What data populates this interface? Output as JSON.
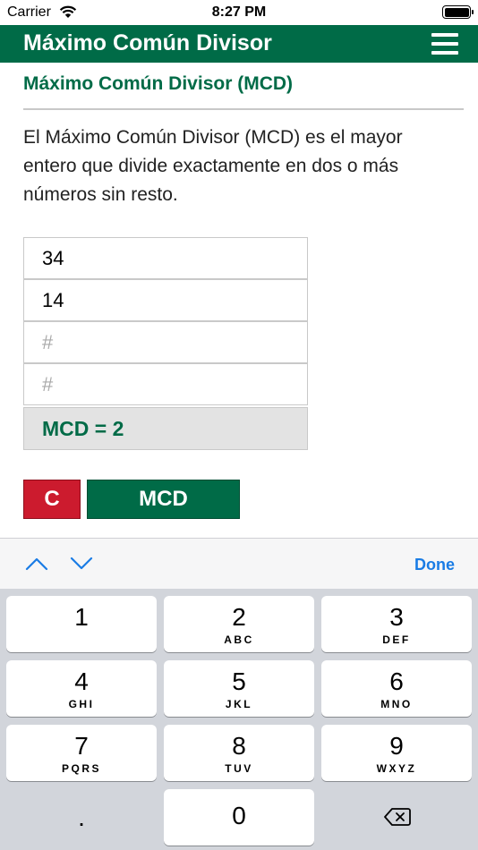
{
  "status_bar": {
    "carrier": "Carrier",
    "time": "8:27 PM",
    "icons": [
      "wifi-icon",
      "battery-icon"
    ]
  },
  "header": {
    "title": "Máximo Común Divisor",
    "menu_icon": "hamburger-menu-icon"
  },
  "section_title": "Máximo Común Divisor (MCD)",
  "description": "El Máximo Común Divisor (MCD) es el mayor entero que divide exactamente en dos o más números sin resto.",
  "inputs": [
    {
      "value": "34",
      "placeholder": "#"
    },
    {
      "value": "14",
      "placeholder": "#"
    },
    {
      "value": "",
      "placeholder": "#"
    },
    {
      "value": "",
      "placeholder": "#"
    }
  ],
  "result": "MCD = 2",
  "buttons": {
    "clear": "C",
    "calculate": "MCD"
  },
  "accessory": {
    "done": "Done",
    "icons": [
      "chevron-up-icon",
      "chevron-down-icon"
    ]
  },
  "keypad": {
    "keys": [
      {
        "digit": "1",
        "letters": ""
      },
      {
        "digit": "2",
        "letters": "ABC"
      },
      {
        "digit": "3",
        "letters": "DEF"
      },
      {
        "digit": "4",
        "letters": "GHI"
      },
      {
        "digit": "5",
        "letters": "JKL"
      },
      {
        "digit": "6",
        "letters": "MNO"
      },
      {
        "digit": "7",
        "letters": "PQRS"
      },
      {
        "digit": "8",
        "letters": "TUV"
      },
      {
        "digit": "9",
        "letters": "WXYZ"
      }
    ],
    "dot": ".",
    "zero": "0",
    "backspace_icon": "backspace-icon"
  },
  "colors": {
    "brand_green": "#006b47",
    "clear_red": "#cc1b2e",
    "link_blue": "#1a7ce5",
    "keypad_bg": "#d2d5db"
  }
}
